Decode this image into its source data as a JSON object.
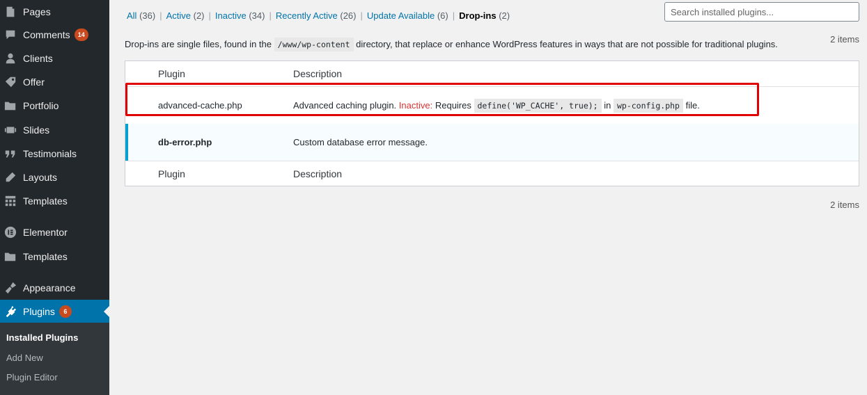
{
  "sidebar": {
    "items": [
      {
        "label": "Pages",
        "icon": "pages-icon"
      },
      {
        "label": "Comments",
        "icon": "comments-icon",
        "badge": "14"
      },
      {
        "label": "Clients",
        "icon": "clients-icon"
      },
      {
        "label": "Offer",
        "icon": "offer-icon"
      },
      {
        "label": "Portfolio",
        "icon": "portfolio-icon"
      },
      {
        "label": "Slides",
        "icon": "slides-icon"
      },
      {
        "label": "Testimonials",
        "icon": "testimonials-icon"
      },
      {
        "label": "Layouts",
        "icon": "layouts-icon"
      },
      {
        "label": "Templates",
        "icon": "templates-icon"
      },
      {
        "label": "Elementor",
        "icon": "elementor-icon"
      },
      {
        "label": "Templates",
        "icon": "templates-folder-icon"
      },
      {
        "label": "Appearance",
        "icon": "appearance-icon"
      },
      {
        "label": "Plugins",
        "icon": "plugins-icon",
        "badge": "6"
      }
    ],
    "submenu": [
      "Installed Plugins",
      "Add New",
      "Plugin Editor"
    ]
  },
  "filters": {
    "all": "All",
    "all_count": "(36)",
    "active": "Active",
    "active_count": "(2)",
    "inactive": "Inactive",
    "inactive_count": "(34)",
    "recent": "Recently Active",
    "recent_count": "(26)",
    "update": "Update Available",
    "update_count": "(6)",
    "dropins": "Drop-ins",
    "dropins_count": "(2)"
  },
  "search": {
    "placeholder": "Search installed plugins..."
  },
  "description": {
    "before": "Drop-ins are single files, found in the",
    "path": "/www/wp-content",
    "after": "directory, that replace or enhance WordPress features in ways that are not possible for traditional plugins."
  },
  "items_count": "2 items",
  "table": {
    "col_plugin": "Plugin",
    "col_description": "Description",
    "rows": [
      {
        "name": "advanced-cache.php",
        "desc": "Advanced caching plugin.",
        "status": "Inactive:",
        "requires": "Requires",
        "code1": "define('WP_CACHE', true);",
        "in": "in",
        "code2": "wp-config.php",
        "tail": "file."
      },
      {
        "name": "db-error.php",
        "desc": "Custom database error message."
      }
    ]
  },
  "colors": {
    "accent": "#0073aa",
    "highlight": "#e00000",
    "inactive": "#dc3232",
    "badge": "#ca4a1f"
  }
}
